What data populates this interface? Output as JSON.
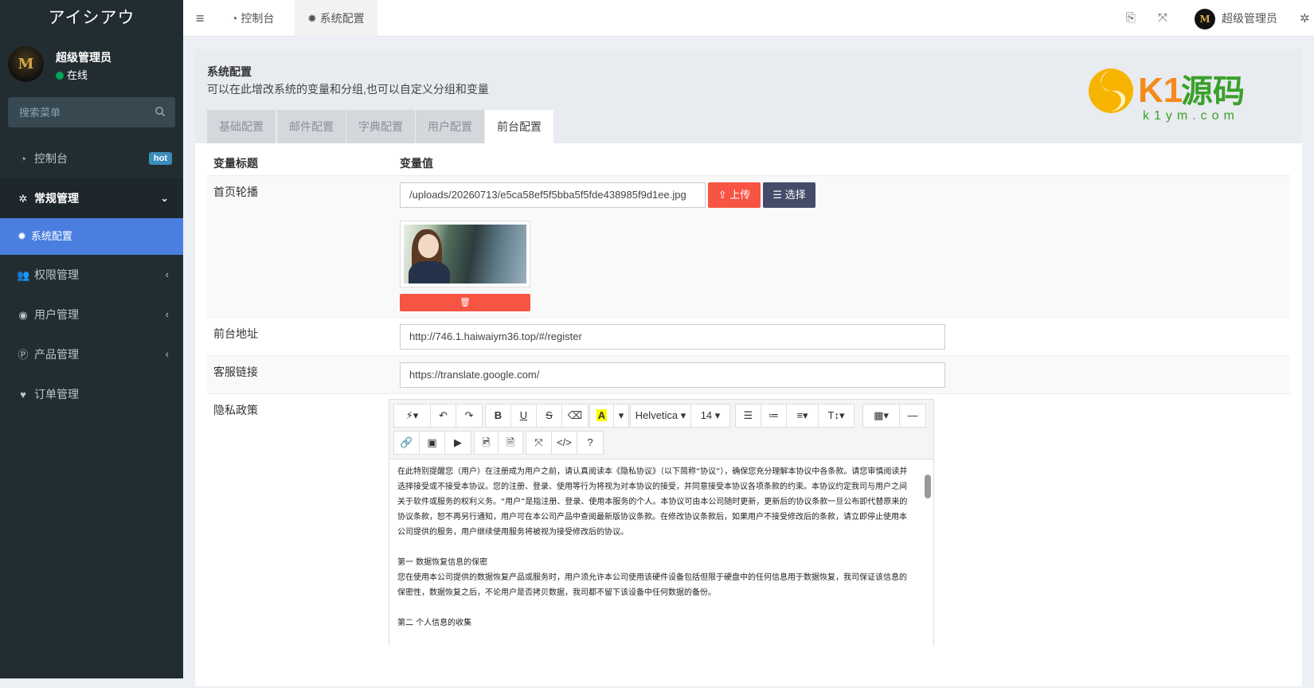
{
  "app": {
    "brand": "アイシアウ"
  },
  "user": {
    "name": "超级管理员",
    "status": "在线",
    "avatar_letter": "M"
  },
  "search": {
    "placeholder": "搜索菜单"
  },
  "sidebar": {
    "items": [
      {
        "label": "控制台",
        "icon": "dashboard-icon",
        "badge": "hot"
      },
      {
        "label": "常规管理",
        "icon": "cogs-icon",
        "open": true
      },
      {
        "label": "系统配置",
        "icon": "gear-icon",
        "active": true
      },
      {
        "label": "权限管理",
        "icon": "users-icon"
      },
      {
        "label": "用户管理",
        "icon": "user-circle-icon"
      },
      {
        "label": "产品管理",
        "icon": "product-icon"
      },
      {
        "label": "订单管理",
        "icon": "heartbeat-icon"
      }
    ]
  },
  "topbar": {
    "tabs": [
      {
        "label": "控制台"
      },
      {
        "label": "系统配置"
      }
    ],
    "admin_name": "超级管理员"
  },
  "panel": {
    "title": "系统配置",
    "description": "可以在此增改系统的变量和分组,也可以自定义分组和变量",
    "tabs": [
      "基础配置",
      "邮件配置",
      "字典配置",
      "用户配置",
      "前台配置"
    ],
    "active_tab": "前台配置"
  },
  "watermark": {
    "brand": "K1源码",
    "domain": "k1ym.com"
  },
  "table": {
    "col_title": "变量标题",
    "col_value": "变量值",
    "rows": {
      "banner": {
        "label": "首页轮播",
        "value": "/uploads/20260713/e5ca58ef5f5bba5f5fde438985f9d1ee.jpg",
        "upload": "上传",
        "choose": "选择"
      },
      "frontend": {
        "label": "前台地址",
        "value": "http://746.1.haiwaiym36.top/#/register"
      },
      "service": {
        "label": "客服链接",
        "value": "https://translate.google.com/"
      },
      "privacy": {
        "label": "隐私政策"
      }
    }
  },
  "editor": {
    "font": "Helvetica",
    "size": "14",
    "paragraphs": [
      "在此特别提醒您（用户）在注册成为用户之前，请认真阅读本《隐私协议》（以下简称“协议”），确保您充分理解本协议中各条款。请您审慎阅读并选择接受或不接受本协议。您的注册、登录、使用等行为将视为对本协议的接受，并同意接受本协议各项条款的约束。本协议约定我司与用户之间关于软件或服务的权利义务。“用户”是指注册、登录、使用本服务的个人。本协议可由本公司随时更新，更新后的协议条款一旦公布即代替原来的协议条款，恕不再另行通知，用户可在本公司产品中查阅最新版协议条款。在修改协议条款后，如果用户不接受修改后的条款，请立即停止使用本公司提供的服务，用户继续使用服务将被视为接受修改后的协议。",
      "第一 数据恢复信息的保密",
      "您在使用本公司提供的数据恢复产品或服务时，用户须允许本公司使用该硬件设备包括但限于硬盘中的任何信息用于数据恢复，我司保证该信息的保密性，数据恢复之后，不论用户是否拷贝数据，我司都不留下该设备中任何数据的备份。",
      "第二 个人信息的收集"
    ]
  }
}
